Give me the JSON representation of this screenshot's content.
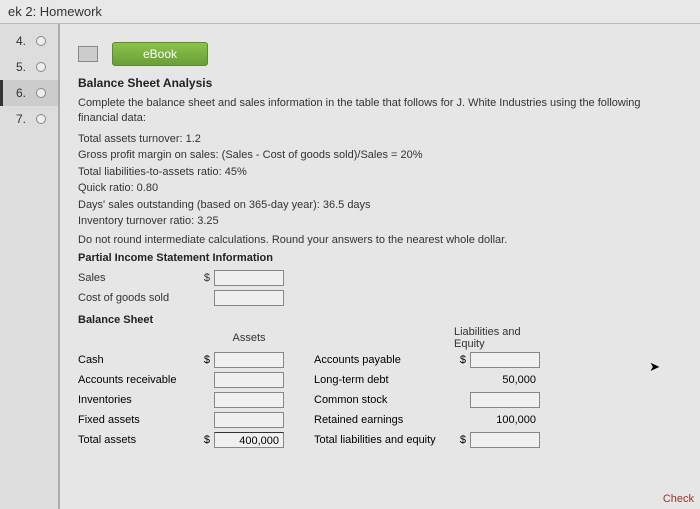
{
  "header": {
    "title": "ek 2: Homework"
  },
  "sidebar": {
    "items": [
      {
        "num": "4."
      },
      {
        "num": "5."
      },
      {
        "num": "6."
      },
      {
        "num": "7."
      }
    ]
  },
  "ebook": {
    "label": "eBook"
  },
  "page": {
    "title": "Balance Sheet Analysis",
    "instructions": "Complete the balance sheet and sales information in the table that follows for J. White Industries using the following financial data:",
    "financial_data": [
      "Total assets turnover: 1.2",
      "Gross profit margin on sales: (Sales - Cost of goods sold)/Sales = 20%",
      "Total liabilities-to-assets ratio: 45%",
      "Quick ratio: 0.80",
      "Days' sales outstanding (based on 365-day year): 36.5 days",
      "Inventory turnover ratio: 3.25"
    ],
    "note": "Do not round intermediate calculations. Round your answers to the nearest whole dollar.",
    "pis_heading": "Partial Income Statement Information",
    "pis": {
      "sales_label": "Sales",
      "cogs_label": "Cost of goods sold",
      "dollar": "$"
    },
    "bs_heading": "Balance Sheet",
    "bs": {
      "assets_label": "Assets",
      "liab_label": "Liabilities and Equity",
      "cash": "Cash",
      "ar": "Accounts receivable",
      "inv": "Inventories",
      "fixed": "Fixed assets",
      "total_assets": "Total assets",
      "ap": "Accounts payable",
      "ltd": "Long-term debt",
      "cs": "Common stock",
      "re": "Retained earnings",
      "total_le": "Total liabilities and equity",
      "dollar": "$",
      "total_assets_val": "400,000",
      "ltd_val": "50,000",
      "re_val": "100,000"
    }
  },
  "footer": {
    "check": "Check"
  }
}
